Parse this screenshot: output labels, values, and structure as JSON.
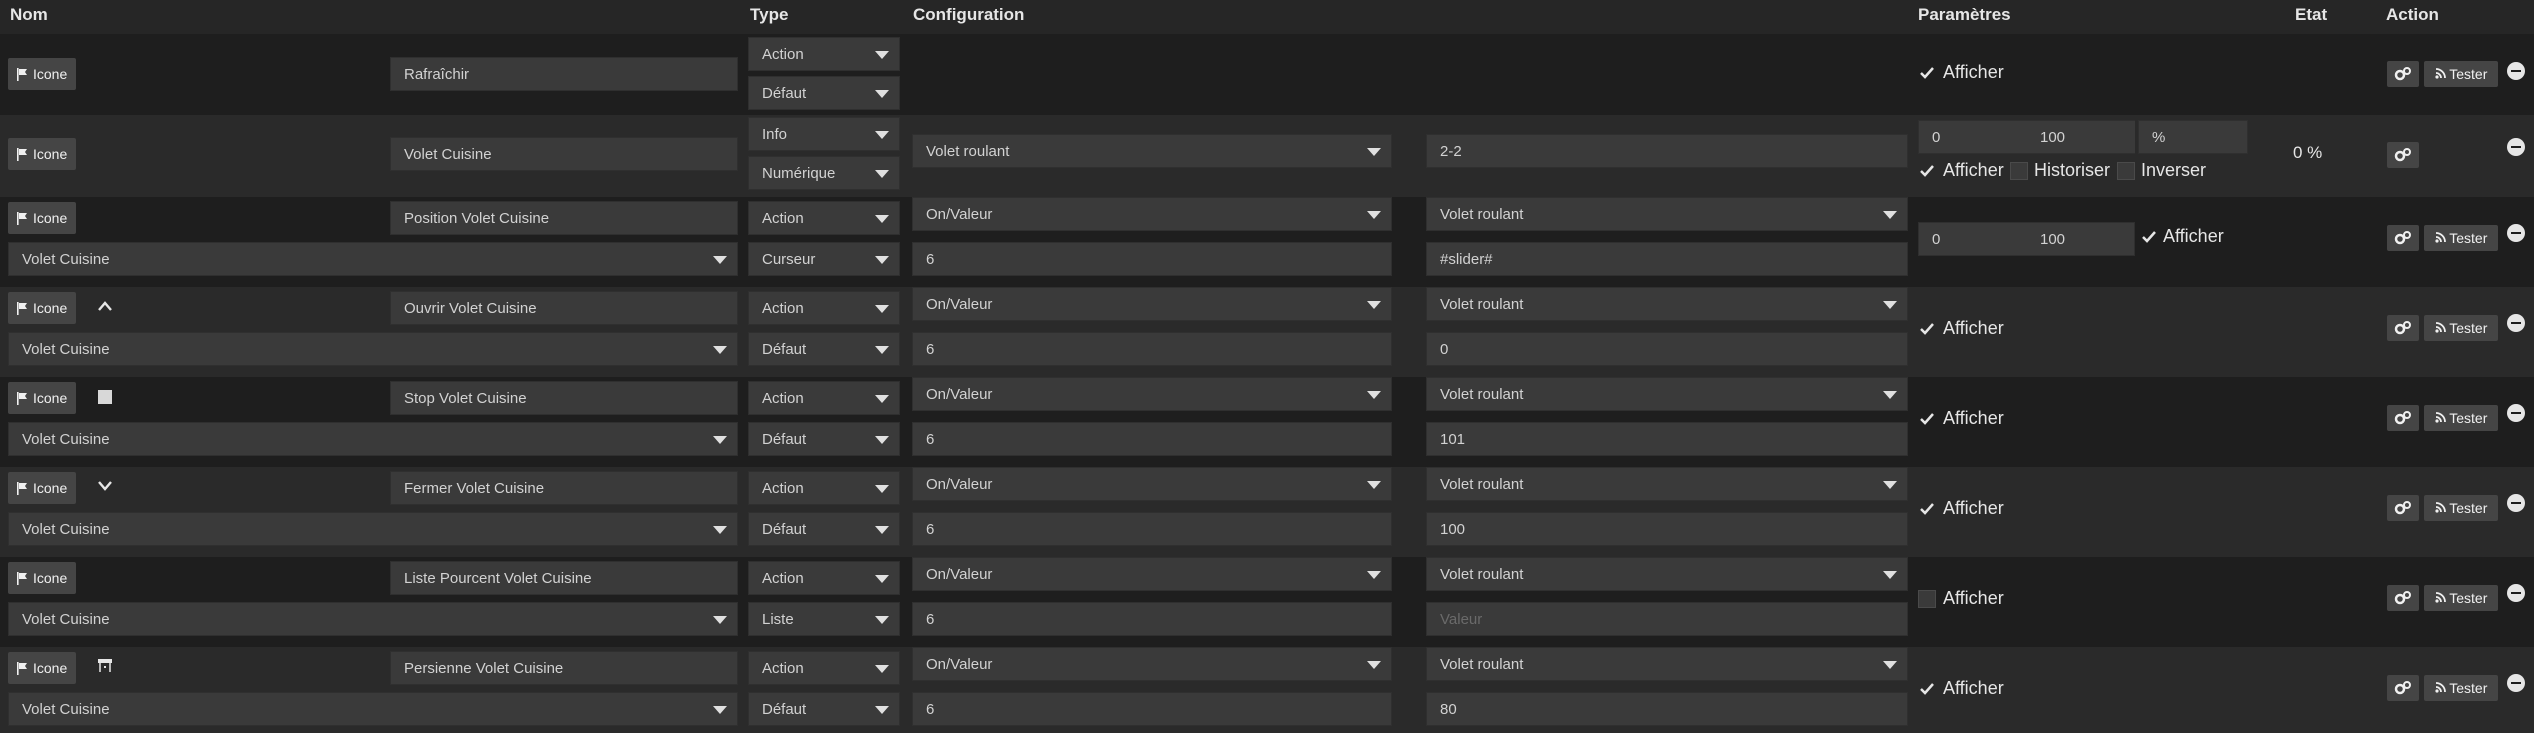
{
  "headers": {
    "nom": "Nom",
    "type": "Type",
    "configuration": "Configuration",
    "parametres": "Paramètres",
    "etat": "Etat",
    "action": "Action"
  },
  "common": {
    "icone_label": "Icone",
    "afficher_label": "Afficher",
    "historiser_label": "Historiser",
    "inverser_label": "Inverser",
    "tester_label": "Tester"
  },
  "rows": [
    {
      "name": "Rafraîchir",
      "type1": "Action",
      "type2": "Défaut",
      "afficher": true
    },
    {
      "name": "Volet Cuisine",
      "type1": "Info",
      "type2": "Numérique",
      "conf1": "Volet roulant",
      "conf2": "2-2",
      "min": "0",
      "max": "100",
      "unit": "%",
      "afficher": true,
      "historiser": false,
      "inverser": false,
      "etat": "0 %"
    },
    {
      "name": "Position Volet Cuisine",
      "parent": "Volet Cuisine",
      "type1": "Action",
      "type2": "Curseur",
      "conf1": "On/Valeur",
      "conf2": "Volet roulant",
      "conf3": "6",
      "conf4": "#slider#",
      "min": "0",
      "max": "100",
      "afficher": true
    },
    {
      "name": "Ouvrir Volet Cuisine",
      "parent": "Volet Cuisine",
      "type1": "Action",
      "type2": "Défaut",
      "conf1": "On/Valeur",
      "conf2": "Volet roulant",
      "conf3": "6",
      "conf4": "0",
      "afficher": true,
      "icon": "chevron-up-icon"
    },
    {
      "name": "Stop Volet Cuisine",
      "parent": "Volet Cuisine",
      "type1": "Action",
      "type2": "Défaut",
      "conf1": "On/Valeur",
      "conf2": "Volet roulant",
      "conf3": "6",
      "conf4": "101",
      "afficher": true,
      "icon": "stop-square-icon"
    },
    {
      "name": "Fermer Volet Cuisine",
      "parent": "Volet Cuisine",
      "type1": "Action",
      "type2": "Défaut",
      "conf1": "On/Valeur",
      "conf2": "Volet roulant",
      "conf3": "6",
      "conf4": "100",
      "afficher": true,
      "icon": "chevron-down-icon"
    },
    {
      "name": "Liste Pourcent Volet Cuisine",
      "parent": "Volet Cuisine",
      "type1": "Action",
      "type2": "Liste",
      "conf1": "On/Valeur",
      "conf2": "Volet roulant",
      "conf3": "6",
      "conf4_placeholder": "Valeur",
      "afficher": false
    },
    {
      "name": "Persienne Volet Cuisine",
      "parent": "Volet Cuisine",
      "type1": "Action",
      "type2": "Défaut",
      "conf1": "On/Valeur",
      "conf2": "Volet roulant",
      "conf3": "6",
      "conf4": "80",
      "afficher": true,
      "icon": "shutter-icon"
    }
  ]
}
